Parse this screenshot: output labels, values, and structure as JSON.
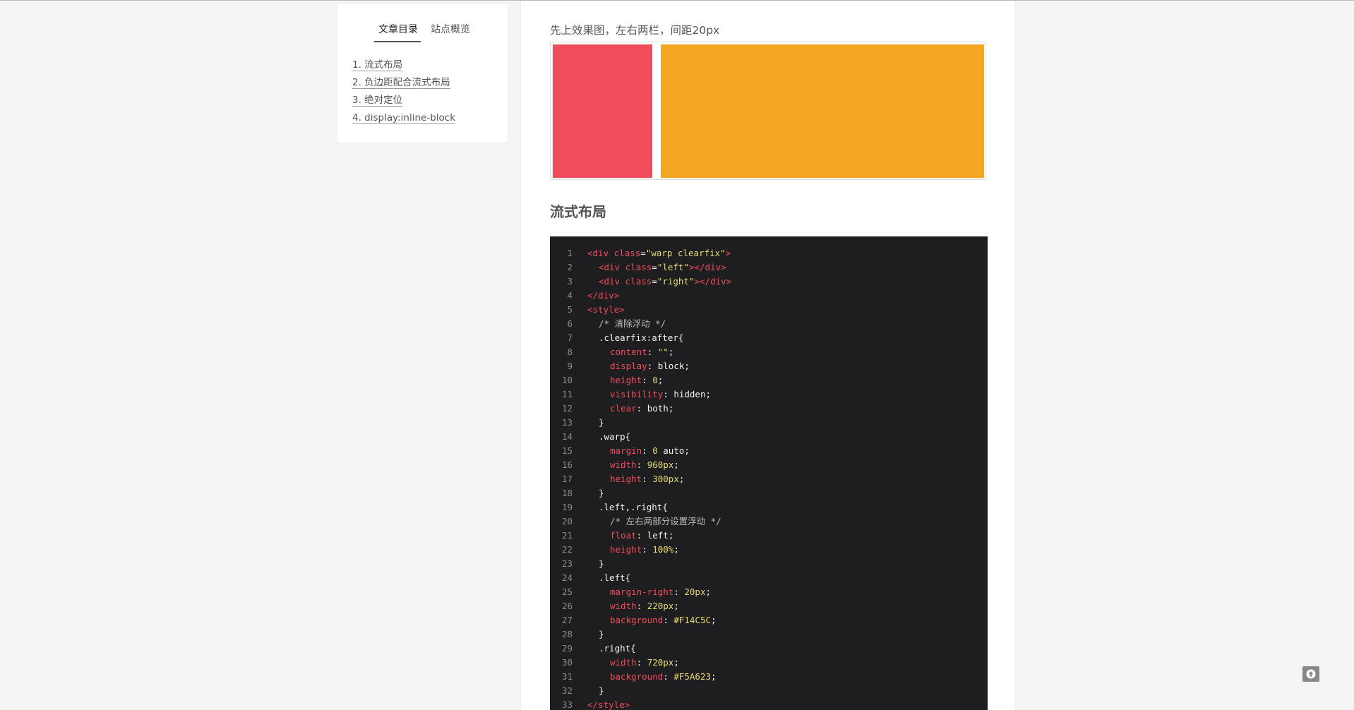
{
  "sidebar": {
    "tabs": [
      {
        "label": "文章目录",
        "active": true
      },
      {
        "label": "站点概览",
        "active": false
      }
    ],
    "toc": [
      "1. 流式布局",
      "2. 负边距配合流式布局",
      "3. 绝对定位",
      "4. display:inline-block"
    ]
  },
  "article": {
    "intro": "先上效果图，左右两栏，间距20px",
    "demo_colors": {
      "left": "#F14C5C",
      "right": "#F5A623"
    },
    "section_title": "流式布局",
    "code": {
      "line_numbers": [
        "1",
        "2",
        "3",
        "4",
        "5",
        "6",
        "7",
        "8",
        "9",
        "10",
        "11",
        "12",
        "13",
        "14",
        "15",
        "16",
        "17",
        "18",
        "19",
        "20",
        "21",
        "22",
        "23",
        "24",
        "25",
        "26",
        "27",
        "28",
        "29",
        "30",
        "31",
        "32",
        "33"
      ],
      "t": {
        "open_div": "<div ",
        "class_attr": "class",
        "eq": "=",
        "warp_cls": "\"warp clearfix\"",
        "gt": ">",
        "left_cls": "\"left\"",
        "right_cls": "\"right\"",
        "close_tag_gt": "></div>",
        "close_div": "</div>",
        "style_open": "<style>",
        "comment1": "/* 清除浮动 */",
        "clearfix_sel": ".clearfix:after{",
        "content_p": "content",
        "colon": ": ",
        "content_v": "\"\"",
        "semi": ";",
        "display_p": "display",
        "block_v": "block",
        "height_p": "height",
        "zero_v": "0",
        "visibility_p": "visibility",
        "hidden_v": "hidden",
        "clear_p": "clear",
        "both_v": "both",
        "close_brace": "}",
        "warp_sel": ".warp{",
        "margin_p": "margin",
        "auto_v": " auto",
        "width_p": "width",
        "w960": "960px",
        "h300": "300px",
        "lr_sel": ".left,.right{",
        "comment2": "/* 左右两部分设置浮动 */",
        "float_p": "float",
        "left_v": "left",
        "h100": "100%",
        "left_sel": ".left{",
        "mr_p": "margin-right",
        "px20": "20px",
        "w220": "220px",
        "bg_p": "background",
        "c_left": "#F14C5C",
        "right_sel": ".right{",
        "w720": "720px",
        "c_right": "#F5A623",
        "style_close": "</style>"
      }
    }
  },
  "ui": {
    "back_to_top_icon": "arrow-up-icon"
  }
}
